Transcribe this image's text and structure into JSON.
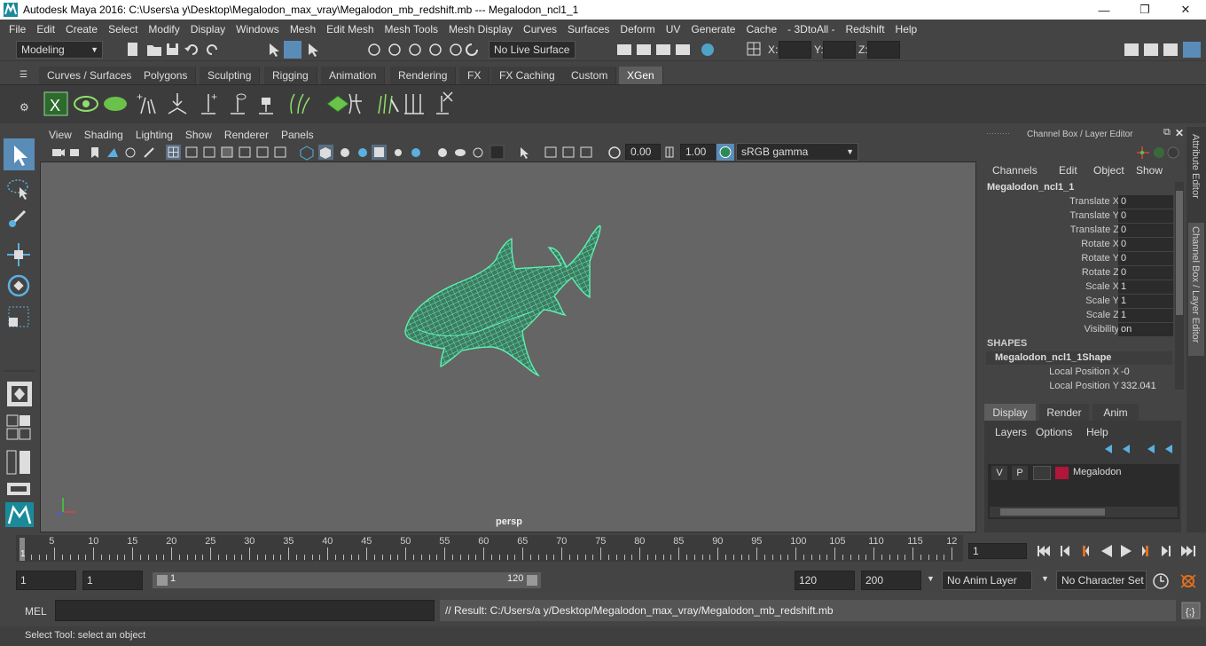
{
  "window": {
    "title": "Autodesk Maya 2016: C:\\Users\\a y\\Desktop\\Megalodon_max_vray\\Megalodon_mb_redshift.mb   ---   Megalodon_ncl1_1",
    "minimize": "—",
    "maximize": "❐",
    "close": "✕"
  },
  "menubar": [
    "File",
    "Edit",
    "Create",
    "Select",
    "Modify",
    "Display",
    "Windows",
    "Mesh",
    "Edit Mesh",
    "Mesh Tools",
    "Mesh Display",
    "Curves",
    "Surfaces",
    "Deform",
    "UV",
    "Generate",
    "Cache",
    "- 3DtoAll -",
    "Redshift",
    "Help"
  ],
  "statusline": {
    "mode": "Modeling",
    "live_surface": "No Live Surface",
    "x_label": "X:",
    "y_label": "Y:",
    "z_label": "Z:"
  },
  "shelf_tabs": [
    {
      "label": "Curves / Surfaces"
    },
    {
      "label": "Polygons"
    },
    {
      "label": "Sculpting"
    },
    {
      "label": "Rigging"
    },
    {
      "label": "Animation"
    },
    {
      "label": "Rendering"
    },
    {
      "label": "FX"
    },
    {
      "label": "FX Caching"
    },
    {
      "label": "Custom"
    },
    {
      "label": "XGen"
    }
  ],
  "active_shelf_tab": "XGen",
  "viewport": {
    "menu": [
      "View",
      "Shading",
      "Lighting",
      "Show",
      "Renderer",
      "Panels"
    ],
    "exposure": "0.00",
    "gamma": "1.00",
    "color_space": "sRGB gamma",
    "camera": "persp",
    "model_color": "#5ef0b0"
  },
  "channel_box": {
    "header": "Channel Box / Layer Editor",
    "menu": [
      "Channels",
      "Edit",
      "Object",
      "Show"
    ],
    "object": "Megalodon_ncl1_1",
    "attributes": [
      {
        "label": "Translate X",
        "value": "0"
      },
      {
        "label": "Translate Y",
        "value": "0"
      },
      {
        "label": "Translate Z",
        "value": "0"
      },
      {
        "label": "Rotate X",
        "value": "0"
      },
      {
        "label": "Rotate Y",
        "value": "0"
      },
      {
        "label": "Rotate Z",
        "value": "0"
      },
      {
        "label": "Scale X",
        "value": "1"
      },
      {
        "label": "Scale Y",
        "value": "1"
      },
      {
        "label": "Scale Z",
        "value": "1"
      },
      {
        "label": "Visibility",
        "value": "on"
      }
    ],
    "shapes_header": "SHAPES",
    "shape_name": "Megalodon_ncl1_1Shape",
    "shape_attributes": [
      {
        "label": "Local Position X",
        "value": "-0"
      },
      {
        "label": "Local Position Y",
        "value": "332.041"
      }
    ]
  },
  "layer_editor": {
    "tabs": [
      "Display",
      "Render",
      "Anim"
    ],
    "active_tab": "Display",
    "menu": [
      "Layers",
      "Options",
      "Help"
    ],
    "layer": {
      "v": "V",
      "p": "P",
      "name": "Megalodon",
      "color": "#b0163a"
    }
  },
  "side_tabs": {
    "attribute_editor": "Attribute Editor",
    "channel_box": "Channel Box / Layer Editor"
  },
  "timeline": {
    "ticks": [
      "5",
      "10",
      "15",
      "20",
      "25",
      "30",
      "35",
      "40",
      "45",
      "50",
      "55",
      "60",
      "65",
      "70",
      "75",
      "80",
      "85",
      "90",
      "95",
      "100",
      "105",
      "110",
      "115",
      "12"
    ],
    "start_marker": "1",
    "current_frame": "1"
  },
  "range": {
    "start": "1",
    "playback_start": "1",
    "slider_start": "1",
    "slider_end": "120",
    "playback_end": "120",
    "end": "200",
    "anim_layer": "No Anim Layer",
    "character_set": "No Character Set"
  },
  "command": {
    "mel_label": "MEL",
    "result": "// Result: C:/Users/a y/Desktop/Megalodon_max_vray/Megalodon_mb_redshift.mb"
  },
  "help_line": "Select Tool: select an object"
}
